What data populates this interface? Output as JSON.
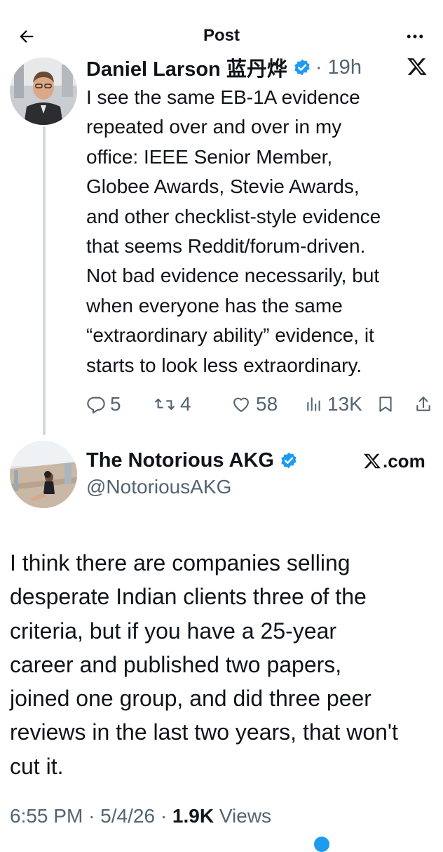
{
  "header": {
    "title": "Post"
  },
  "tweet1": {
    "author_name": "Daniel Larson 蓝丹烨",
    "time": "· 19h",
    "body_lines": [
      "I see the same EB-1A evidence",
      "repeated over and over in my",
      "office: IEEE Senior Member,",
      "Globee Awards, Stevie Awards,",
      "and other checklist-style evidence",
      "that seems Reddit/forum-driven.",
      "Not bad evidence necessarily, but",
      "when everyone has the same",
      "“extraordinary ability” evidence, it",
      "starts to look less extraordinary."
    ],
    "actions": {
      "replies": "5",
      "reposts": "4",
      "likes": "58",
      "views": "13K"
    }
  },
  "tweet2": {
    "author_name": "The Notorious AKG",
    "handle": "@NotoriousAKG",
    "source": ".com",
    "body_lines": [
      "I think there are companies selling",
      "desperate Indian clients three of the",
      "criteria, but if you have a 25-year",
      "career and published two papers,",
      "joined one group, and did three peer",
      "reviews in the last two years, that won't",
      "cut it."
    ],
    "meta": {
      "time": "6:55 PM",
      "date": "5/4/26",
      "views_count": "1.9K",
      "views_label": "Views"
    }
  },
  "colors": {
    "verified": "#1d9bf0",
    "text_primary": "#0f1419",
    "text_secondary": "#536471",
    "thread_line": "#cfd9de"
  },
  "icons": {
    "back": "arrow-left-icon",
    "more": "more-horizontal-icon",
    "x_logo": "x-logo-icon",
    "reply": "reply-icon",
    "repost": "repost-icon",
    "like": "heart-icon",
    "views": "bar-chart-icon",
    "bookmark": "bookmark-icon",
    "share": "share-icon"
  }
}
